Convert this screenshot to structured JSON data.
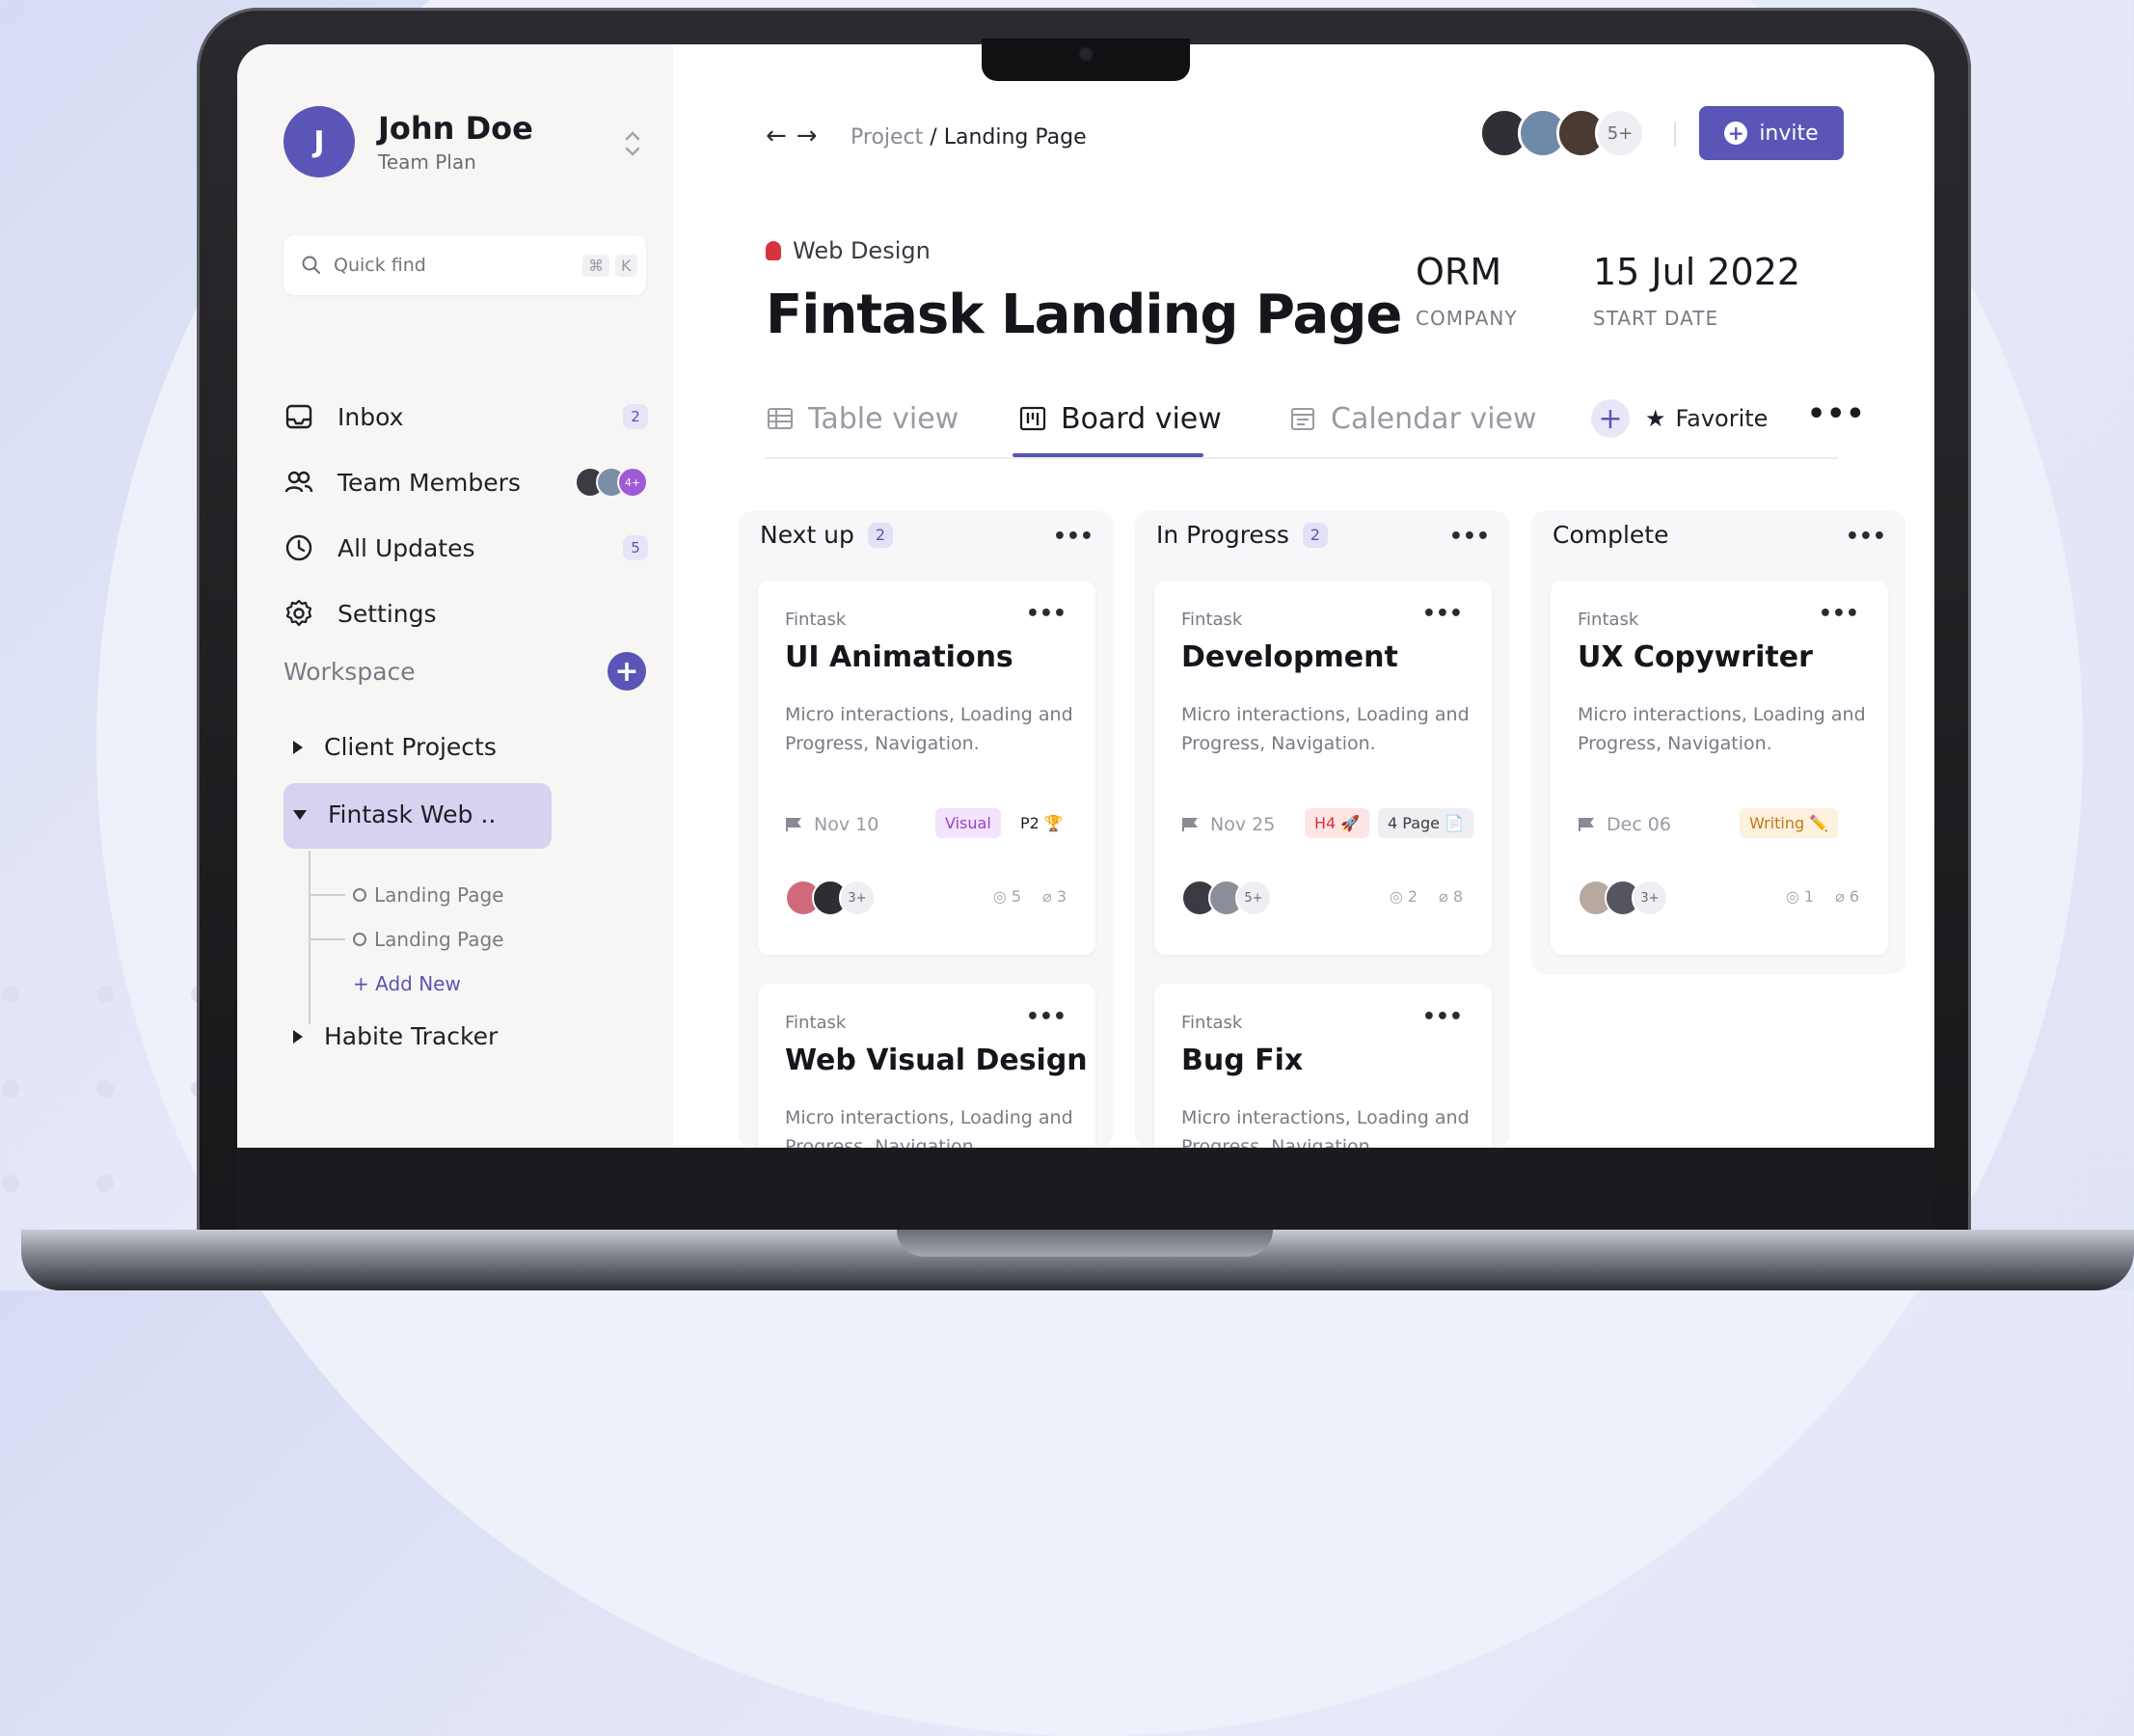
{
  "colors": {
    "accent": "#5a55b6",
    "sidebar_bg": "#f7f6f4",
    "category_dot": "#d8323c"
  },
  "user": {
    "initial": "J",
    "name": "John Doe",
    "plan": "Team Plan"
  },
  "search": {
    "placeholder": "Quick find",
    "shortcut_1": "⌘",
    "shortcut_2": "K"
  },
  "nav": [
    {
      "label": "Inbox",
      "icon": "inbox-icon",
      "badge": "2"
    },
    {
      "label": "Team Members",
      "icon": "team-icon",
      "badge": "4+"
    },
    {
      "label": "All Updates",
      "icon": "clock-icon",
      "badge": "5"
    },
    {
      "label": "Settings",
      "icon": "gear-icon"
    }
  ],
  "workspace": {
    "label": "Workspace",
    "add": "+",
    "items": [
      {
        "label": "Client Projects"
      },
      {
        "label": "Fintask Web .."
      },
      {
        "label": "Habite Tracker"
      }
    ],
    "sub_items": [
      "Landing Page",
      "Landing Page"
    ],
    "add_new": "+ Add New"
  },
  "header": {
    "breadcrumb_parent": "Project",
    "breadcrumb_sep": "/",
    "breadcrumb_current": "Landing Page",
    "team_more": "5+",
    "invite_label": "invite"
  },
  "project": {
    "category": "Web Design",
    "title": "Fintask Landing Page",
    "company_value": "ORM",
    "company_label": "COMPANY",
    "start_value": "15 Jul 2022",
    "start_label": "START DATE"
  },
  "tabs": {
    "table": "Table view",
    "board": "Board view",
    "calendar": "Calendar view",
    "add": "+",
    "favorite": "Favorite",
    "more": "•••"
  },
  "columns": [
    {
      "title": "Next up",
      "count": "2",
      "cards": [
        {
          "brand": "Fintask",
          "title": "UI Animations",
          "desc": "Micro interactions, Loading and Progress, Navigation.",
          "date": "Nov 10",
          "tags": [
            "Visual",
            "P2 🏆"
          ],
          "more_avatars": "3+",
          "comments": "5",
          "attachments": "3"
        },
        {
          "brand": "Fintask",
          "title": "Web Visual Design",
          "desc": "Micro interactions, Loading and Progress, Navigation."
        }
      ]
    },
    {
      "title": "In Progress",
      "count": "2",
      "cards": [
        {
          "brand": "Fintask",
          "title": "Development",
          "desc": "Micro interactions, Loading and Progress, Navigation.",
          "date": "Nov 25",
          "tags": [
            "H4 🚀",
            "4 Page 📄"
          ],
          "more_avatars": "5+",
          "comments": "2",
          "attachments": "8"
        },
        {
          "brand": "Fintask",
          "title": "Bug Fix",
          "desc": "Micro interactions, Loading and Progress, Navigation."
        }
      ]
    },
    {
      "title": "Complete",
      "cards": [
        {
          "brand": "Fintask",
          "title": "UX Copywriter",
          "desc": "Micro interactions, Loading and Progress, Navigation.",
          "date": "Dec 06",
          "tags": [
            "Writing ✏️"
          ],
          "more_avatars": "3+",
          "comments": "1",
          "attachments": "6"
        }
      ]
    }
  ]
}
